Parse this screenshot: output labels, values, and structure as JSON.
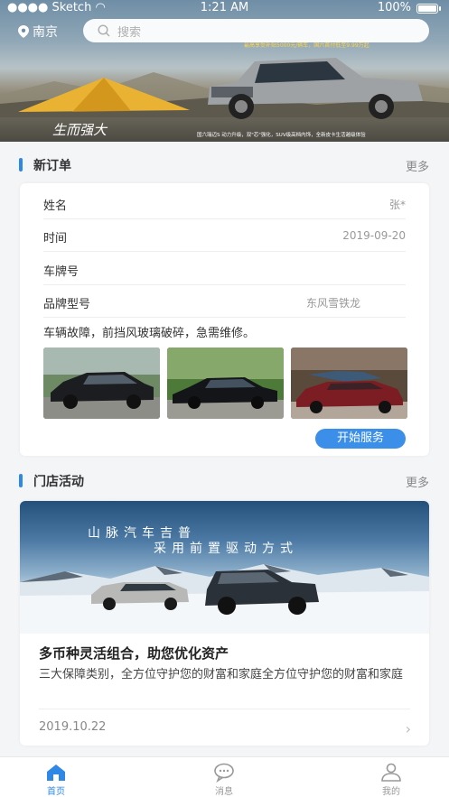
{
  "status_bar": {
    "carrier": "Sketch",
    "time": "1:21 AM",
    "battery": "100%"
  },
  "header": {
    "city": "南京",
    "search_placeholder": "搜索"
  },
  "banner": {
    "brand_slogan": "生而强大",
    "promo_top": "最高享受补贴5000元/辆车，国六首付低至9.99万起",
    "promo_bottom": "国六瑞迈S 动力升级，双\"芯\"强化，SUV级高档内饰，全新皮卡生活越级体验"
  },
  "new_orders": {
    "title": "新订单",
    "more": "更多",
    "fields": [
      {
        "label": "姓名",
        "value": "张*"
      },
      {
        "label": "时间",
        "value": "2019-09-20"
      },
      {
        "label": "车牌号",
        "value": ""
      },
      {
        "label": "品牌型号",
        "value": "东风雪铁龙"
      }
    ],
    "description": "车辆故障，前挡风玻璃破碎，急需维修。",
    "photos": [
      "suv-photo",
      "sedan-photo",
      "showroom-photo"
    ],
    "start_button": "开始服务"
  },
  "store_activity": {
    "title": "门店活动",
    "more": "更多",
    "image_line1": "山脉汽车吉普",
    "image_line2": "采用前置驱动方式",
    "card_title": "多币种灵活组合，助您优化资产",
    "card_desc": "三大保障类别，全方位守护您的财富和家庭全方位守护您的财富和家庭",
    "date": "2019.10.22"
  },
  "tabbar": [
    {
      "label": "首页",
      "icon": "home-icon",
      "active": true
    },
    {
      "label": "消息",
      "icon": "message-icon",
      "active": false
    },
    {
      "label": "我的",
      "icon": "user-icon",
      "active": false
    }
  ],
  "colors": {
    "accent": "#2f87e6",
    "button": "#3b8fe8"
  }
}
